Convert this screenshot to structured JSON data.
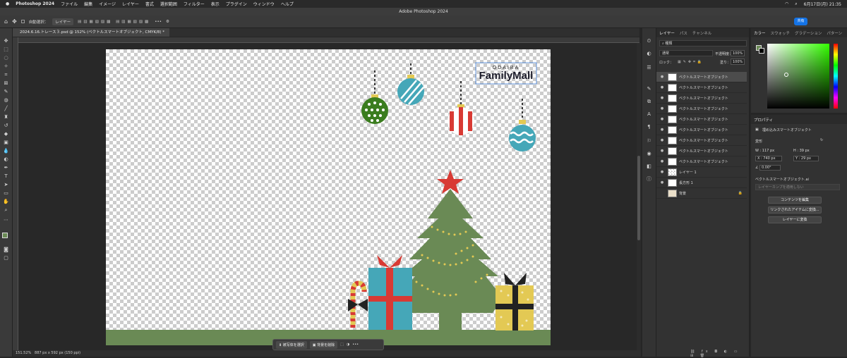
{
  "menubar": {
    "app": "Photoshop 2024",
    "items": [
      "ファイル",
      "編集",
      "イメージ",
      "レイヤー",
      "書式",
      "選択範囲",
      "フィルター",
      "表示",
      "プラグイン",
      "ウィンドウ",
      "ヘルプ"
    ],
    "clock": "6月17日(月) 21:35"
  },
  "window": {
    "title": "Adobe Photoshop 2024"
  },
  "options": {
    "autoselect_label": "自動選択：",
    "autoselect_value": "レイヤー",
    "more": "•••",
    "share": "共有"
  },
  "document": {
    "tab": "2024.6.16.トレース３.psd @ 152% (ベクトルスマートオブジェクト, CMYK/8) *"
  },
  "status": {
    "zoom": "151.52%",
    "size": "887 px x 592 px (150 ppi)"
  },
  "ctxbar": {
    "select_subject": "被写体を選択",
    "remove_bg": "背景を削除",
    "more": "•••"
  },
  "artwork": {
    "logo_top": "ODAIBA",
    "logo_main": "FamilyMall"
  },
  "layers": {
    "tabs": [
      "レイヤー",
      "パス",
      "チャンネル"
    ],
    "kind": "種類",
    "blend": "通常",
    "opacity_label": "不透明度：",
    "opacity": "100%",
    "lock_label": "ロック：",
    "fill_label": "塗り：",
    "fill": "100%",
    "list": [
      {
        "name": "ベクトルスマートオブジェクト",
        "selected": true
      },
      {
        "name": "ベクトルスマートオブジェクト"
      },
      {
        "name": "ベクトルスマートオブジェクト"
      },
      {
        "name": "ベクトルスマートオブジェクト"
      },
      {
        "name": "ベクトルスマートオブジェクト"
      },
      {
        "name": "ベクトルスマートオブジェクト"
      },
      {
        "name": "ベクトルスマートオブジェクト"
      },
      {
        "name": "ベクトルスマートオブジェクト"
      },
      {
        "name": "ベクトルスマートオブジェクト"
      },
      {
        "name": "レイヤー 1"
      },
      {
        "name": "長方形 1"
      },
      {
        "name": "背景"
      }
    ]
  },
  "color_tabs": [
    "カラー",
    "スウォッチ",
    "グラデーション",
    "パターン"
  ],
  "properties": {
    "tab": "プロパティ",
    "type": "埋め込みスマートオブジェクト",
    "transform": "変形",
    "w": "W : 117 px",
    "h": "H : 39 px",
    "x": "X : 740 px",
    "y": "Y : 29 px",
    "angle": "0.00°",
    "file": "ベクトルスマートオブジェクト.ai",
    "comp": "レイヤーカンプを適用しない",
    "btn_edit": "コンテンツを編集",
    "btn_convert_link": "リンクされたアイテムに変換...",
    "btn_convert_layer": "レイヤーに変換"
  },
  "colors": {
    "tree": "#6a8a55",
    "ground": "#6a8a55",
    "red": "#d83a34",
    "teal": "#45a7b8",
    "yellow": "#e3c954",
    "green_ball": "#3b7d1f"
  }
}
